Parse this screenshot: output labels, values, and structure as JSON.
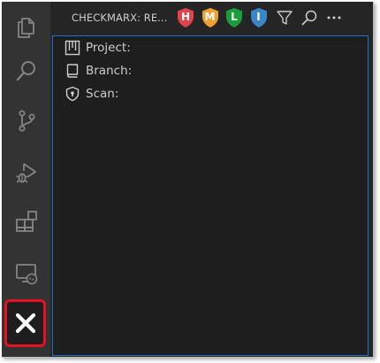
{
  "sidebar": {
    "title": "CHECKMARX: RE...",
    "severity_filters": [
      {
        "letter": "H",
        "label": "High",
        "color": "#e0434b"
      },
      {
        "letter": "M",
        "label": "Medium",
        "color": "#f0a030"
      },
      {
        "letter": "L",
        "label": "Low",
        "color": "#1a9e3c"
      },
      {
        "letter": "I",
        "label": "Info",
        "color": "#3a87c8"
      }
    ],
    "actions": {
      "filter_icon": "filter-icon",
      "search_icon": "search-icon",
      "more_icon": "more-icon"
    }
  },
  "tree": {
    "items": [
      {
        "label": "Project:",
        "icon": "project-icon"
      },
      {
        "label": "Branch:",
        "icon": "branch-book-icon"
      },
      {
        "label": "Scan:",
        "icon": "scan-shield-icon"
      }
    ]
  },
  "activity_bar": {
    "items": [
      {
        "name": "explorer",
        "icon": "files-icon"
      },
      {
        "name": "search",
        "icon": "search-icon"
      },
      {
        "name": "source-control",
        "icon": "source-control-icon"
      },
      {
        "name": "run-and-debug",
        "icon": "run-debug-icon"
      },
      {
        "name": "extensions",
        "icon": "extensions-icon"
      },
      {
        "name": "remote-explorer",
        "icon": "remote-explorer-icon"
      },
      {
        "name": "checkmarx",
        "icon": "checkmarx-icon",
        "selected": true
      }
    ],
    "highlight_color": "#e81123"
  }
}
